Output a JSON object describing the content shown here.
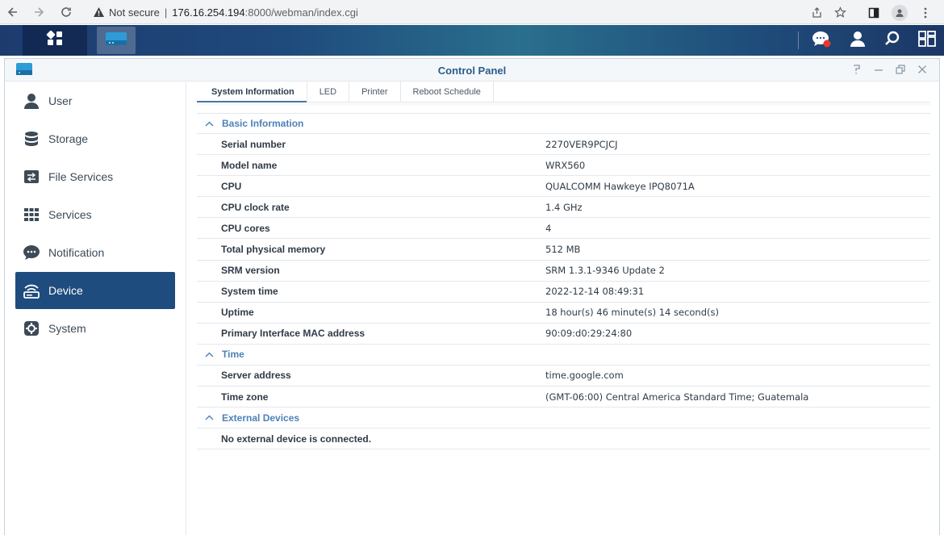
{
  "browser": {
    "not_secure_label": "Not secure",
    "url_host": "176.16.254.194",
    "url_path": ":8000/webman/index.cgi"
  },
  "window": {
    "title": "Control Panel"
  },
  "sidebar": {
    "items": [
      {
        "label": "User",
        "icon": "user-icon"
      },
      {
        "label": "Storage",
        "icon": "database-icon"
      },
      {
        "label": "File Services",
        "icon": "file-services-icon"
      },
      {
        "label": "Services",
        "icon": "grid-icon"
      },
      {
        "label": "Notification",
        "icon": "chat-bubble-icon"
      },
      {
        "label": "Device",
        "icon": "router-icon"
      },
      {
        "label": "System",
        "icon": "gear-icon"
      }
    ],
    "active_index": 5
  },
  "tabs": [
    {
      "label": "System Information"
    },
    {
      "label": "LED"
    },
    {
      "label": "Printer"
    },
    {
      "label": "Reboot Schedule"
    }
  ],
  "sections": {
    "basic": {
      "title": "Basic Information",
      "rows": [
        {
          "key": "Serial number",
          "value": "2270VER9PCJCJ"
        },
        {
          "key": "Model name",
          "value": "WRX560"
        },
        {
          "key": "CPU",
          "value": "QUALCOMM Hawkeye IPQ8071A"
        },
        {
          "key": "CPU clock rate",
          "value": "1.4 GHz"
        },
        {
          "key": "CPU cores",
          "value": "4"
        },
        {
          "key": "Total physical memory",
          "value": "512 MB"
        },
        {
          "key": "SRM version",
          "value": "SRM 1.3.1-9346 Update 2"
        },
        {
          "key": "System time",
          "value": "2022-12-14 08:49:31"
        },
        {
          "key": "Uptime",
          "value": "18 hour(s) 46 minute(s) 14 second(s)"
        },
        {
          "key": "Primary Interface MAC address",
          "value": "90:09:d0:29:24:80"
        }
      ]
    },
    "time": {
      "title": "Time",
      "rows": [
        {
          "key": "Server address",
          "value": "time.google.com"
        },
        {
          "key": "Time zone",
          "value": "(GMT-06:00) Central America Standard Time; Guatemala"
        }
      ]
    },
    "external": {
      "title": "External Devices",
      "message": "No external device is connected."
    }
  },
  "colors": {
    "accent": "#1f4c7e",
    "section_title": "#4d81b8",
    "window_title": "#2b5b8a"
  }
}
